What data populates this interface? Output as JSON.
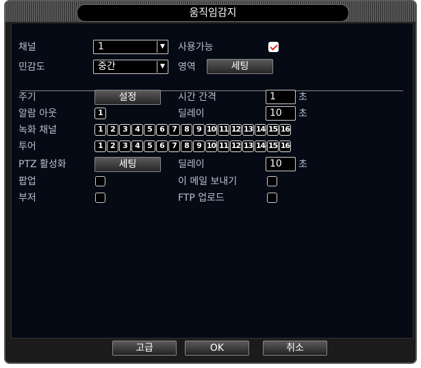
{
  "window": {
    "title": "움직임감지"
  },
  "row_channel": {
    "label": "채널",
    "value": "1",
    "enable_label": "사용가능",
    "enable_checked": true
  },
  "row_sensitivity": {
    "label": "민감도",
    "value": "중간",
    "region_label": "영역",
    "region_button": "세팅"
  },
  "row_period": {
    "label": "주기",
    "button": "설정",
    "interval_label": "시간 간격",
    "interval_value": "1",
    "interval_unit": "초"
  },
  "row_alarm_out": {
    "label": "알람 아웃",
    "value": "1",
    "delay_label": "딜레이",
    "delay_value": "10",
    "delay_unit": "초"
  },
  "row_record_channel": {
    "label": "녹화 채널",
    "channels": [
      "1",
      "2",
      "3",
      "4",
      "5",
      "6",
      "7",
      "8",
      "9",
      "10",
      "11",
      "12",
      "13",
      "14",
      "15",
      "16"
    ]
  },
  "row_tour": {
    "label": "투어",
    "channels": [
      "1",
      "2",
      "3",
      "4",
      "5",
      "6",
      "7",
      "8",
      "9",
      "10",
      "11",
      "12",
      "13",
      "14",
      "15",
      "16"
    ]
  },
  "row_ptz": {
    "label": "PTZ 활성화",
    "button": "세팅",
    "delay_label": "딜레이",
    "delay_value": "10",
    "delay_unit": "초"
  },
  "row_popup": {
    "label": "팝업",
    "checked": false,
    "email_label": "이 메일 보내기",
    "email_checked": false
  },
  "row_buzzer": {
    "label": "부저",
    "checked": false,
    "ftp_label": "FTP 업로드",
    "ftp_checked": false
  },
  "footer": {
    "advanced": "고급",
    "ok": "OK",
    "cancel": "취소"
  },
  "colors": {
    "background": "#050a14",
    "label": "#b9c0cf",
    "check_mark": "#e02020"
  }
}
